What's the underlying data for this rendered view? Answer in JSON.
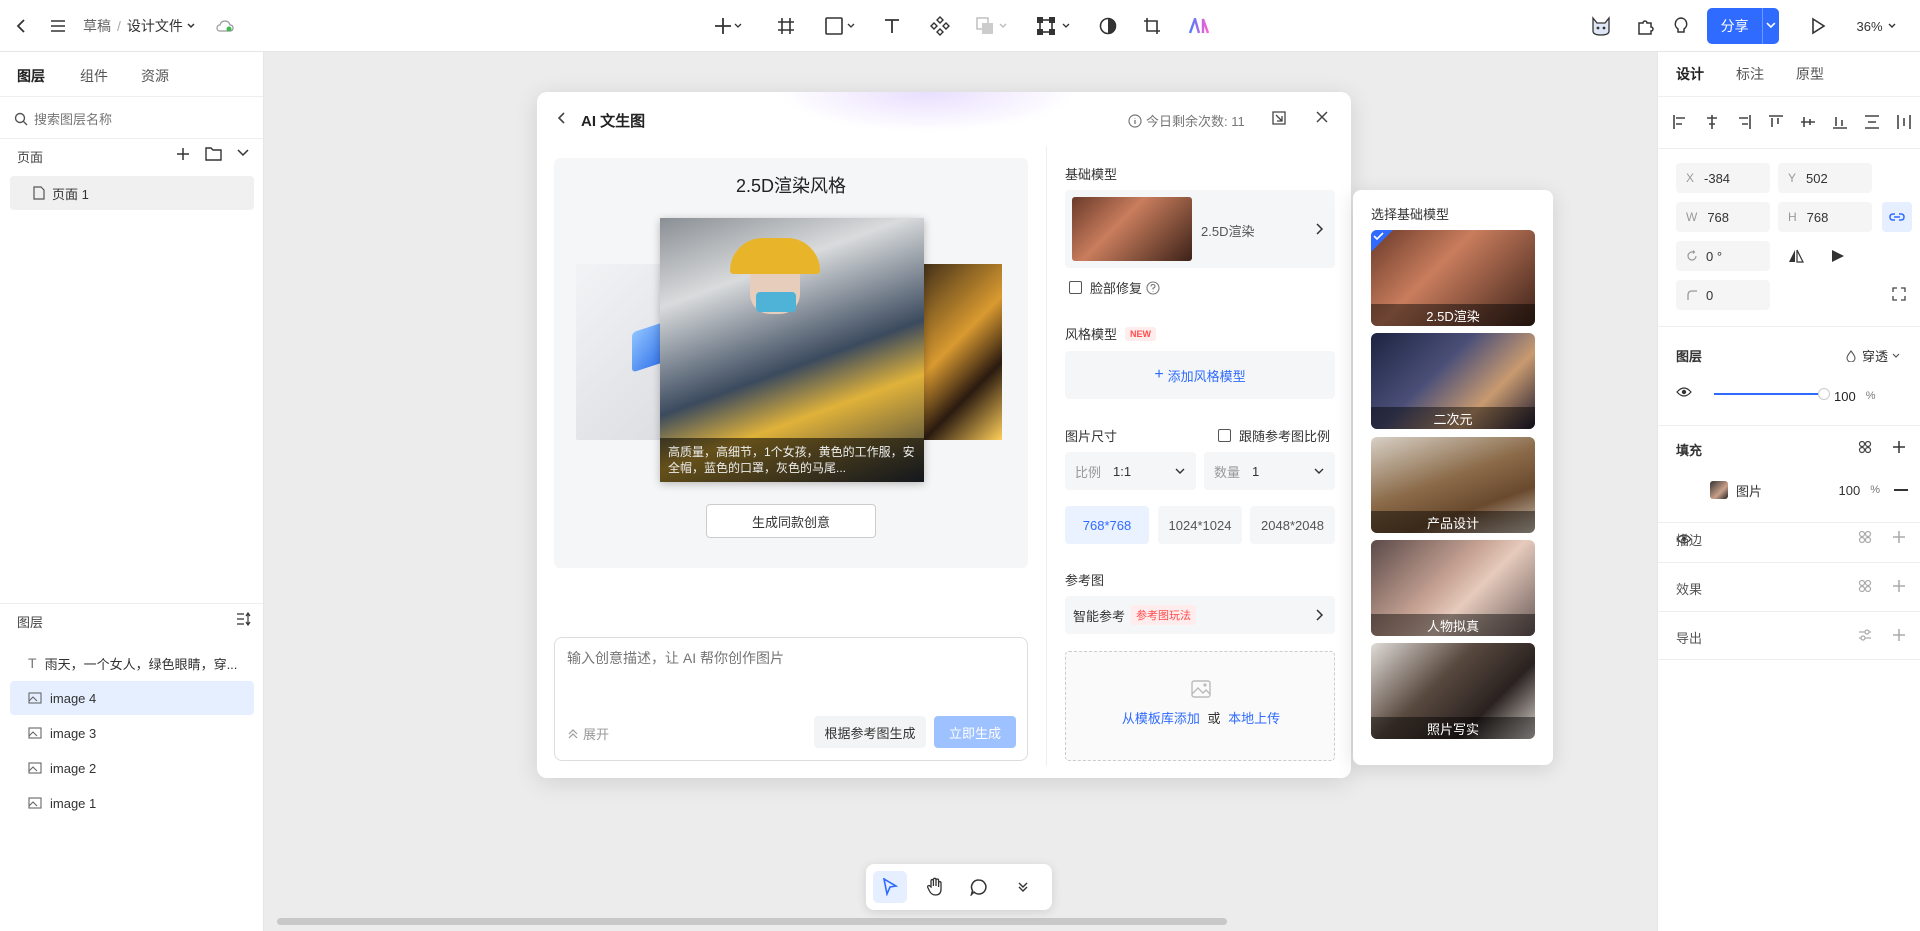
{
  "topbar": {
    "breadcrumb_root": "草稿",
    "breadcrumb_sep": "/",
    "breadcrumb_current": "设计文件",
    "share_label": "分享",
    "zoom": "36%"
  },
  "left": {
    "tabs": [
      "图层",
      "组件",
      "资源"
    ],
    "search_placeholder": "搜索图层名称",
    "pages_title": "页面",
    "pages": [
      "页面 1"
    ],
    "layers_title": "图层",
    "layers": [
      {
        "icon": "text-icon",
        "label": "雨天，一个女人，绿色眼睛，穿..."
      },
      {
        "icon": "image-icon",
        "label": "image 4"
      },
      {
        "icon": "image-icon",
        "label": "image 3"
      },
      {
        "icon": "image-icon",
        "label": "image 2"
      },
      {
        "icon": "image-icon",
        "label": "image 1"
      }
    ]
  },
  "modal": {
    "title": "AI 文生图",
    "quota": "今日剩余次数: 11",
    "preview_title": "2.5D渲染风格",
    "preview_caption": "高质量，高细节，1个女孩，黄色的工作服，安全帽，蓝色的口罩，灰色的马尾...",
    "same_style_button": "生成同款创意",
    "prompt_placeholder": "输入创意描述，让 AI 帮你创作图片",
    "expand_label": "展开",
    "ref_generate_button": "根据参考图生成",
    "generate_button": "立即生成",
    "base_model_title": "基础模型",
    "base_model_name": "2.5D渲染",
    "face_fix_label": "脸部修复",
    "style_model_title": "风格模型",
    "style_model_badge": "NEW",
    "add_style_label": "添加风格模型",
    "size_title": "图片尺寸",
    "follow_ref_label": "跟随参考图比例",
    "ratio_label": "比例",
    "ratio_value": "1:1",
    "count_label": "数量",
    "count_value": "1",
    "sizes": [
      "768*768",
      "1024*1024",
      "2048*2048"
    ],
    "ref_title": "参考图",
    "smart_ref_label": "智能参考",
    "smart_ref_badge": "参考图玩法",
    "upload_from_lib": "从模板库添加",
    "upload_or": "或",
    "upload_local": "本地上传"
  },
  "model_selector": {
    "title": "选择基础模型",
    "models": [
      "2.5D渲染",
      "二次元",
      "产品设计",
      "人物拟真",
      "照片写实"
    ]
  },
  "right": {
    "tabs": [
      "设计",
      "标注",
      "原型"
    ],
    "x_label": "X",
    "x_value": "-384",
    "y_label": "Y",
    "y_value": "502",
    "w_label": "W",
    "w_value": "768",
    "h_label": "H",
    "h_value": "768",
    "rotation_value": "0 °",
    "radius_value": "0",
    "layer_title": "图层",
    "blend_mode": "穿透",
    "opacity_value": "100",
    "opacity_fraction": 1.0,
    "percent": "%",
    "fill_title": "填充",
    "fill_type": "图片",
    "fill_opacity": "100",
    "stroke_title": "描边",
    "effect_title": "效果",
    "export_title": "导出"
  },
  "colors": {
    "accent": "#2f6bff",
    "accent_light": "#eaf1ff",
    "generate_disabled": "#9ec1ff",
    "badge_red": "#ff4d4f"
  }
}
